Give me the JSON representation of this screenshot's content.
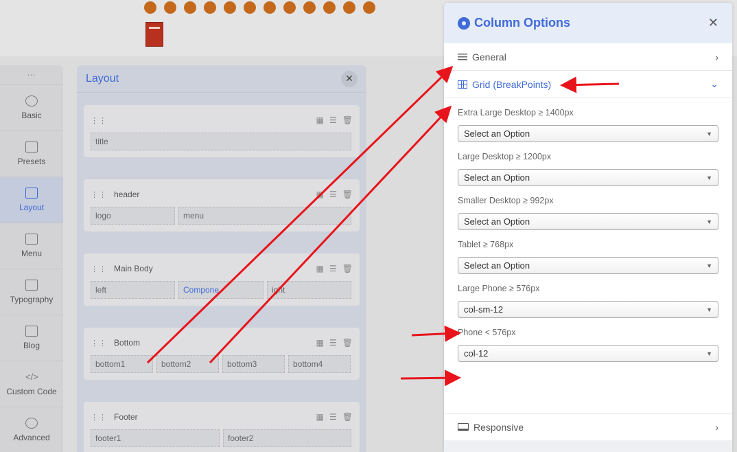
{
  "social_icons": [
    "facebook-icon",
    "x-icon",
    "pinterest-icon",
    "youtube-icon",
    "linkedin-icon",
    "dribbble-icon",
    "instagram-icon",
    "behance-icon",
    "skype-icon",
    "whatsapp-icon",
    "flickr-icon",
    "vk-icon"
  ],
  "sidebar": {
    "items": [
      {
        "label": "Basic",
        "icon": "gear-icon"
      },
      {
        "label": "Presets",
        "icon": "sliders-icon"
      },
      {
        "label": "Layout",
        "icon": "layout-icon"
      },
      {
        "label": "Menu",
        "icon": "menu-icon"
      },
      {
        "label": "Typography",
        "icon": "typography-icon"
      },
      {
        "label": "Blog",
        "icon": "blog-icon"
      },
      {
        "label": "Custom Code",
        "icon": "code-icon"
      },
      {
        "label": "Advanced",
        "icon": "advanced-icon"
      }
    ],
    "active": "Layout"
  },
  "layout_panel": {
    "title": "Layout",
    "rows": [
      {
        "name": "",
        "columns": [
          "title"
        ]
      },
      {
        "name": "header",
        "columns": [
          "logo",
          "menu"
        ]
      },
      {
        "name": "Main Body",
        "columns": [
          "left",
          "Compone",
          "ight"
        ]
      },
      {
        "name": "Bottom",
        "columns": [
          "bottom1",
          "bottom2",
          "bottom3",
          "bottom4"
        ]
      },
      {
        "name": "Footer",
        "columns": [
          "footer1",
          "footer2"
        ]
      }
    ]
  },
  "column_options": {
    "title": "Column Options",
    "sections": {
      "general": "General",
      "grid": "Grid (BreakPoints)",
      "responsive": "Responsive"
    },
    "fields": [
      {
        "label": "Extra Large Desktop ≥ 1400px",
        "value": "Select an Option"
      },
      {
        "label": "Large Desktop ≥ 1200px",
        "value": "Select an Option"
      },
      {
        "label": "Smaller Desktop ≥ 992px",
        "value": "Select an Option"
      },
      {
        "label": "Tablet ≥ 768px",
        "value": "Select an Option"
      },
      {
        "label": "Large Phone ≥ 576px",
        "value": "col-sm-12"
      },
      {
        "label": "Phone < 576px",
        "value": "col-12"
      }
    ]
  },
  "colors": {
    "accent": "#3f6ad8",
    "annotation_arrow": "#e8141b",
    "social_icon": "#c4691c"
  }
}
